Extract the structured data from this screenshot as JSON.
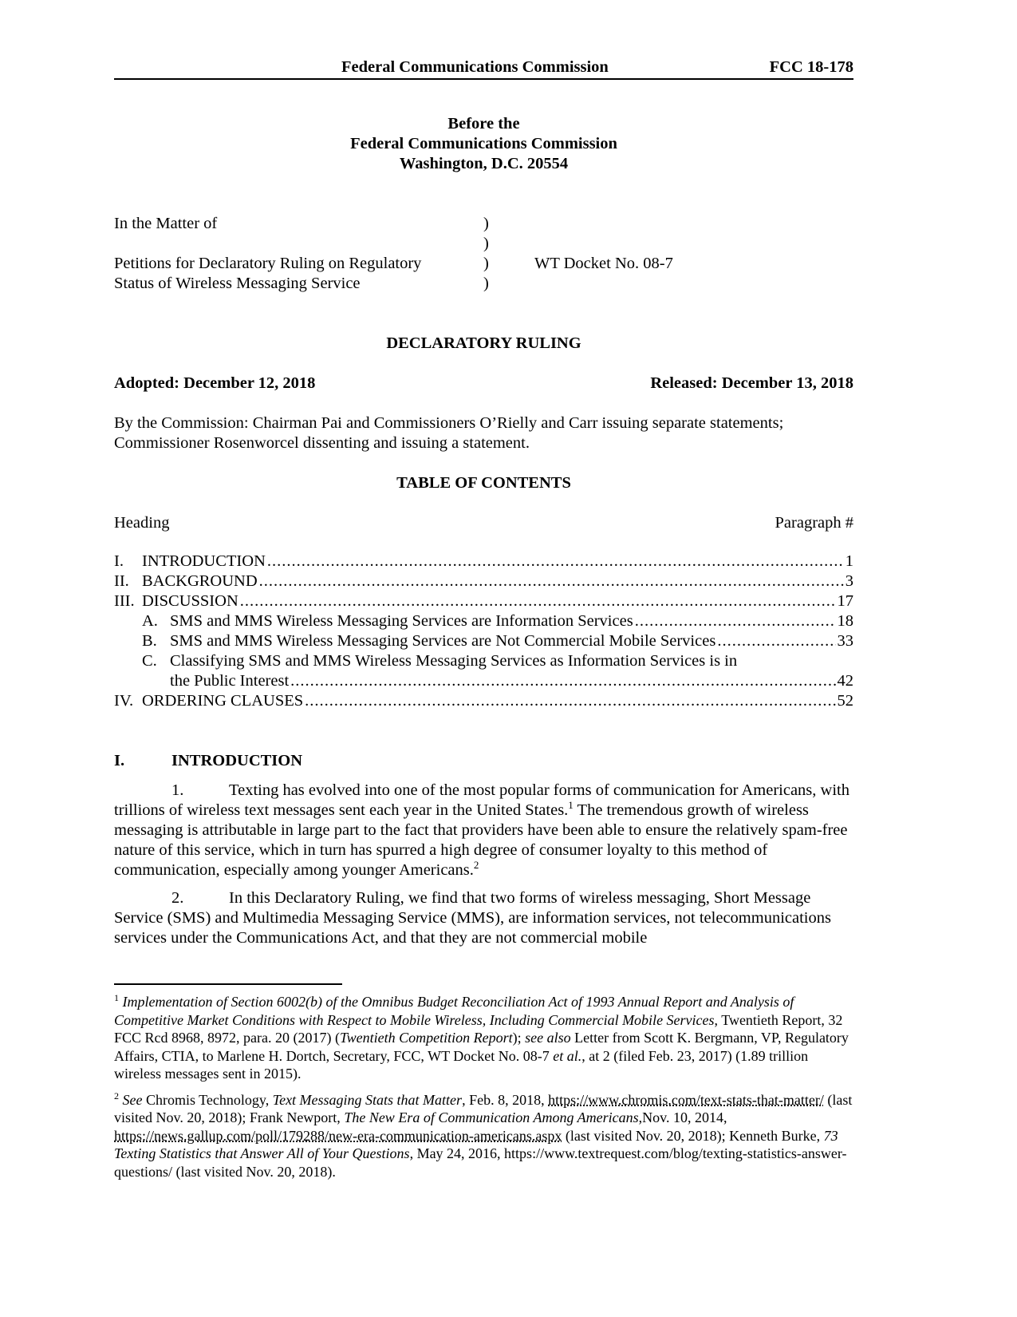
{
  "header": {
    "agency": "Federal Communications Commission",
    "doc_number": "FCC 18-178"
  },
  "before": {
    "line1": "Before the",
    "line2": "Federal Communications Commission",
    "line3": "Washington, D.C. 20554"
  },
  "caption": {
    "rows": [
      {
        "left": "In the Matter of",
        "paren": ")",
        "docket": ""
      },
      {
        "left": "",
        "paren": ")",
        "docket": ""
      },
      {
        "left": "Petitions for Declaratory Ruling on Regulatory",
        "paren": ")",
        "docket": "WT Docket No. 08-7"
      },
      {
        "left": "Status of Wireless Messaging Service",
        "paren": ")",
        "docket": ""
      }
    ]
  },
  "title": "DECLARATORY RULING",
  "dates": {
    "adopted": "Adopted: December 12, 2018",
    "released": "Released: December 13, 2018"
  },
  "by_commission": "By the Commission: Chairman Pai and Commissioners O’Rielly and Carr issuing separate statements; Commissioner Rosenworcel dissenting and issuing a statement.",
  "toc": {
    "title": "TABLE OF CONTENTS",
    "col_heading": "Heading",
    "col_paragraph": "Paragraph #",
    "entries": [
      {
        "num": "I.",
        "label": "INTRODUCTION",
        "page": "1"
      },
      {
        "num": "II.",
        "label": "BACKGROUND",
        "page": "3"
      },
      {
        "num": "III.",
        "label": "DISCUSSION",
        "page": "17"
      },
      {
        "num": "A.",
        "label": "SMS and MMS Wireless Messaging Services are Information Services",
        "page": "18"
      },
      {
        "num": "B.",
        "label": "SMS and MMS Wireless Messaging Services are Not Commercial Mobile Services",
        "page": "33"
      },
      {
        "num": "C.",
        "label": "Classifying SMS and MMS Wireless Messaging Services as Information Services is in",
        "label_cont": "the Public Interest",
        "page": "42"
      },
      {
        "num": "IV.",
        "label": "ORDERING CLAUSES",
        "page": "52"
      }
    ]
  },
  "section": {
    "num": "I.",
    "title": "INTRODUCTION"
  },
  "paragraphs": [
    {
      "num": "1.",
      "text_a": "Texting has evolved into one of the most popular forms of communication for Americans, with trillions of wireless text messages sent each year in the United States.",
      "fn_a": "1",
      "text_b": "  The tremendous growth of wireless messaging is attributable in large part to the fact that providers have been able to ensure the relatively spam-free nature of this service, which in turn has spurred a high degree of consumer loyalty to this method of communication, especially among younger Americans.",
      "fn_b": "2"
    },
    {
      "num": "2.",
      "text": "In this Declaratory Ruling, we find that two forms of wireless messaging, Short Message Service (SMS) and Multimedia Messaging Service (MMS), are information services, not telecommunications services under the Communications Act, and that they are not commercial mobile"
    }
  ],
  "footnotes": [
    {
      "num": "1",
      "i1": "Implementation of Section 6002(b) of the Omnibus Budget Reconciliation Act of 1993 Annual Report and Analysis of Competitive Market Conditions with Respect to Mobile Wireless, Including Commercial Mobile Services",
      "t1": ", Twentieth Report, 32 FCC Rcd 8968, 8972, para. 20 (2017) (",
      "i2": "Twentieth Competition Report",
      "t2": "); ",
      "i3": "see also",
      "t3": " Letter from Scott K. Bergmann, VP, Regulatory Affairs, CTIA, to Marlene H. Dortch, Secretary, FCC, WT Docket No. 08-7 ",
      "i4": "et al.",
      "t4": ", at 2 (filed Feb. 23, 2017) (1.89 trillion wireless messages sent in 2015)."
    },
    {
      "num": "2",
      "i1": "See",
      "t1": " Chromis Technology, ",
      "i2": "Text Messaging Stats that Matter",
      "t2": ", Feb. 8, 2018, ",
      "link1": "https://www.chromis.com/text-stats-that-matter/",
      "t3": " (last visited Nov. 20, 2018); Frank Newport, ",
      "i3": "The New Era of Communication Among Americans",
      "t4": ",Nov. 10, 2014, ",
      "link2": "https://news.gallup.com/poll/179288/new-era-communication-americans.aspx",
      "t5": " (last visited Nov. 20, 2018); Kenneth Burke, ",
      "i4": "73 Texting Statistics that Answer All of Your Questions",
      "t6": ",  May 24, 2016, https://www.textrequest.com/blog/texting-statistics-answer-questions/ (last visited Nov. 20, 2018)."
    }
  ]
}
